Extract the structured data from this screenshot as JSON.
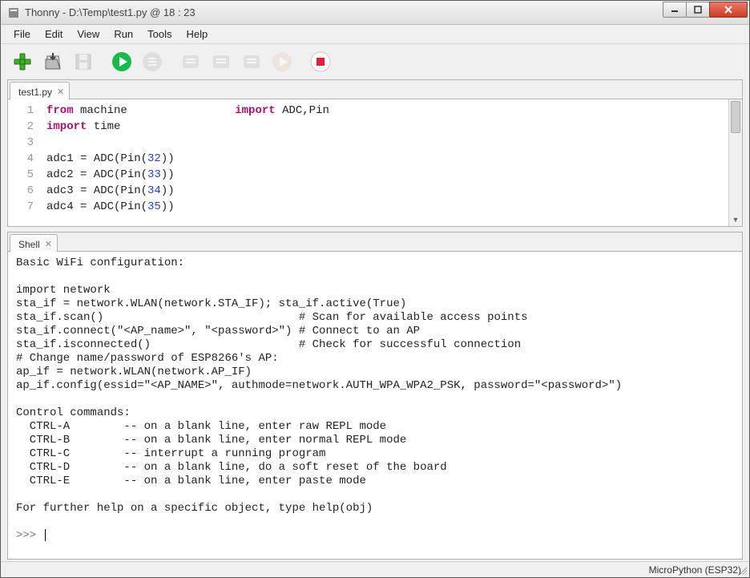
{
  "window": {
    "title": "Thonny  -  D:\\Temp\\test1.py  @  18 : 23"
  },
  "menu": {
    "file": "File",
    "edit": "Edit",
    "view": "View",
    "run": "Run",
    "tools": "Tools",
    "help": "Help"
  },
  "tabs": {
    "editor": "test1.py",
    "shell": "Shell"
  },
  "editor": {
    "gutter": [
      "1",
      "2",
      "3",
      "4",
      "5",
      "6",
      "7"
    ],
    "l1a": "from",
    "l1b": " machine                ",
    "l1c": "import",
    "l1d": " ADC,Pin",
    "l2a": "import",
    "l2b": " time",
    "l3": "",
    "l4a": "adc1 = ADC(Pin(",
    "l4n": "32",
    "l4b": "))",
    "l5a": "adc2 = ADC(Pin(",
    "l5n": "33",
    "l5b": "))",
    "l6a": "adc3 = ADC(Pin(",
    "l6n": "34",
    "l6b": "))",
    "l7a": "adc4 = ADC(Pin(",
    "l7n": "35",
    "l7b": "))"
  },
  "shell": {
    "text": "Basic WiFi configuration:\n\nimport network\nsta_if = network.WLAN(network.STA_IF); sta_if.active(True)\nsta_if.scan()                             # Scan for available access points\nsta_if.connect(\"<AP_name>\", \"<password>\") # Connect to an AP\nsta_if.isconnected()                      # Check for successful connection\n# Change name/password of ESP8266's AP:\nap_if = network.WLAN(network.AP_IF)\nap_if.config(essid=\"<AP_NAME>\", authmode=network.AUTH_WPA_WPA2_PSK, password=\"<password>\")\n\nControl commands:\n  CTRL-A        -- on a blank line, enter raw REPL mode\n  CTRL-B        -- on a blank line, enter normal REPL mode\n  CTRL-C        -- interrupt a running program\n  CTRL-D        -- on a blank line, do a soft reset of the board\n  CTRL-E        -- on a blank line, enter paste mode\n\nFor further help on a specific object, type help(obj)\n",
    "prompt": ">>> "
  },
  "status": {
    "backend": "MicroPython (ESP32)"
  }
}
